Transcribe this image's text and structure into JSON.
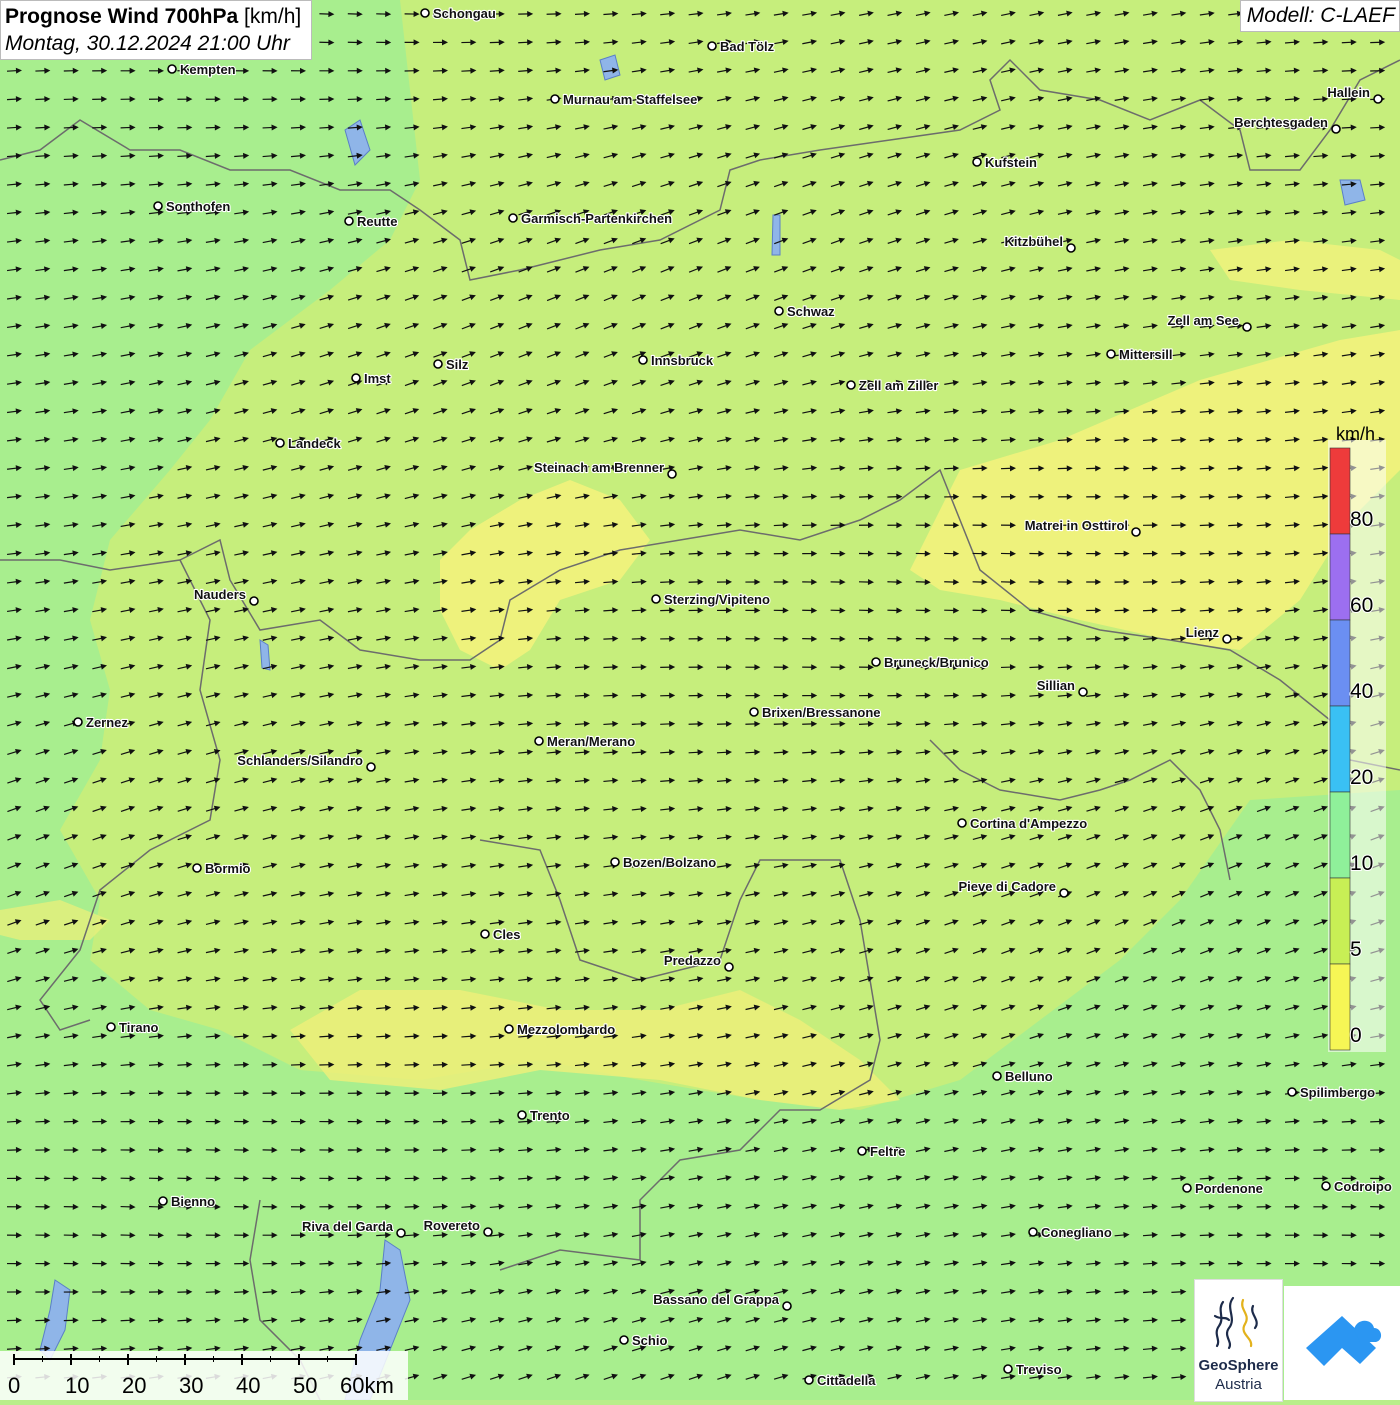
{
  "header": {
    "title_bold": "Prognose Wind 700hPa",
    "title_unit": "[km/h]",
    "subtitle": "Montag, 30.12.2024 21:00 Uhr",
    "model": "Modell: C-LAEF"
  },
  "colors": {
    "calm_yellow": "#f7f77a",
    "light_green": "#c8ee7e",
    "green": "#a6ee8e",
    "arrow": "#111111"
  },
  "cities": [
    {
      "name": "Schongau",
      "label_side": "right"
    },
    {
      "name": "Bad Tölz",
      "label_side": "right"
    },
    {
      "name": "Kempten",
      "label_side": "right"
    },
    {
      "name": "Murnau am Staffelsee",
      "label_side": "right"
    },
    {
      "name": "Hallein",
      "label_side": "left"
    },
    {
      "name": "Berchtesgaden",
      "label_side": "left"
    },
    {
      "name": "Kufstein",
      "label_side": "right"
    },
    {
      "name": "Sonthofen",
      "label_side": "right"
    },
    {
      "name": "Reutte",
      "label_side": "right"
    },
    {
      "name": "Garmisch-Partenkirchen",
      "label_side": "right"
    },
    {
      "name": "Kitzbühel",
      "label_side": "left"
    },
    {
      "name": "Schwaz",
      "label_side": "right"
    },
    {
      "name": "Zell am See",
      "label_side": "left"
    },
    {
      "name": "Mittersill",
      "label_side": "right"
    },
    {
      "name": "Imst",
      "label_side": "right"
    },
    {
      "name": "Silz",
      "label_side": "right"
    },
    {
      "name": "Innsbruck",
      "label_side": "right"
    },
    {
      "name": "Zell am Ziller",
      "label_side": "right"
    },
    {
      "name": "Landeck",
      "label_side": "right"
    },
    {
      "name": "Steinach am Brenner",
      "label_side": "left"
    },
    {
      "name": "Matrei in Osttirol",
      "label_side": "left"
    },
    {
      "name": "Nauders",
      "label_side": "left"
    },
    {
      "name": "Sterzing/Vipiteno",
      "label_side": "right"
    },
    {
      "name": "Lienz",
      "label_side": "left"
    },
    {
      "name": "Bruneck/Brunico",
      "label_side": "right"
    },
    {
      "name": "Sillian",
      "label_side": "left"
    },
    {
      "name": "Zernez",
      "label_side": "right"
    },
    {
      "name": "Brixen/Bressanone",
      "label_side": "right"
    },
    {
      "name": "Meran/Merano",
      "label_side": "right"
    },
    {
      "name": "Schlanders/Silandro",
      "label_side": "left"
    },
    {
      "name": "Cortina d'Ampezzo",
      "label_side": "right"
    },
    {
      "name": "Bozen/Bolzano",
      "label_side": "right"
    },
    {
      "name": "Bormio",
      "label_side": "right"
    },
    {
      "name": "Pieve di Cadore",
      "label_side": "left"
    },
    {
      "name": "Cles",
      "label_side": "right"
    },
    {
      "name": "Predazzo",
      "label_side": "left"
    },
    {
      "name": "Tirano",
      "label_side": "right"
    },
    {
      "name": "Mezzolombardo",
      "label_side": "right"
    },
    {
      "name": "Belluno",
      "label_side": "right"
    },
    {
      "name": "Spilimbergo",
      "label_side": "right"
    },
    {
      "name": "Trento",
      "label_side": "right"
    },
    {
      "name": "Feltre",
      "label_side": "right"
    },
    {
      "name": "Pordenone",
      "label_side": "right"
    },
    {
      "name": "Codroipo",
      "label_side": "right"
    },
    {
      "name": "Bienno",
      "label_side": "right"
    },
    {
      "name": "Riva del Garda",
      "label_side": "left"
    },
    {
      "name": "Rovereto",
      "label_side": "left"
    },
    {
      "name": "Conegliano",
      "label_side": "right"
    },
    {
      "name": "Bassano del Grappa",
      "label_side": "left"
    },
    {
      "name": "Schio",
      "label_side": "right"
    },
    {
      "name": "Treviso",
      "label_side": "right"
    },
    {
      "name": "Cittadella",
      "label_side": "right"
    }
  ],
  "legend": {
    "unit": "km/h",
    "labels": [
      "80",
      "60",
      "40",
      "20",
      "10",
      "5",
      "0"
    ],
    "colors": [
      "#ee3b3b",
      "#9c6ff0",
      "#6b8ff2",
      "#3ac0f4",
      "#8ff09a",
      "#c8ef55",
      "#f6f655"
    ]
  },
  "scale_bar": {
    "labels": [
      "0",
      "10",
      "20",
      "30",
      "40",
      "50",
      "60km"
    ]
  },
  "logo": {
    "name_line1": "GeoSphere",
    "name_line2": "Austria"
  }
}
